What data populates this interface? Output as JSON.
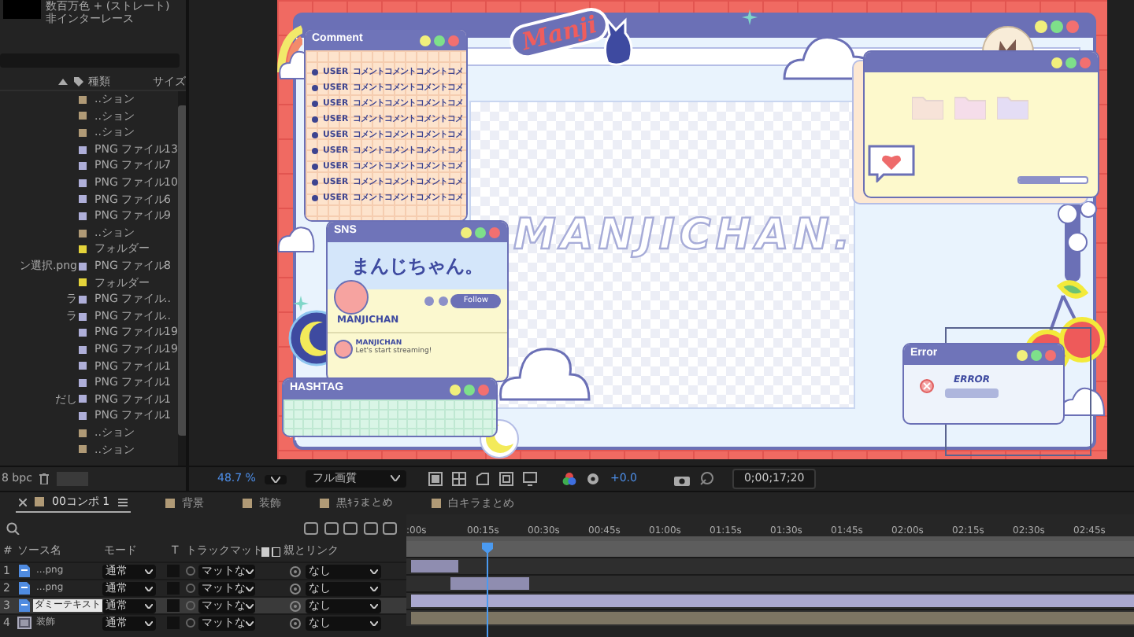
{
  "project": {
    "info": [
      "数百万色 + (ストレート)",
      "非インターレース"
    ],
    "columns": [
      "種類",
      "サイズ"
    ],
    "items": [
      {
        "type": "..ション",
        "color": "#b09a76"
      },
      {
        "type": "..ション",
        "color": "#b09a76"
      },
      {
        "type": "..ション",
        "color": "#b09a76"
      },
      {
        "type": "PNG ファイル",
        "size": "13",
        "color": "#aeaed8"
      },
      {
        "type": "PNG ファイル",
        "size": "7",
        "color": "#aeaed8"
      },
      {
        "type": "PNG ファイル",
        "size": "10",
        "color": "#aeaed8"
      },
      {
        "type": "PNG ファイル",
        "size": "6",
        "color": "#aeaed8"
      },
      {
        "type": "PNG ファイル",
        "size": "9",
        "color": "#aeaed8"
      },
      {
        "type": "..ション",
        "color": "#b09a76"
      },
      {
        "type": "フォルダー",
        "color": "#e4d33a"
      },
      {
        "name": "ン選択.png",
        "type": "PNG ファイル",
        "size": "8",
        "color": "#aeaed8"
      },
      {
        "type": "フォルダー",
        "color": "#e4d33a"
      },
      {
        "name": "ラ",
        "type": "PNG ファイル",
        "size": "..",
        "color": "#aeaed8"
      },
      {
        "name": "ラ",
        "type": "PNG ファイル",
        "size": "..",
        "color": "#aeaed8"
      },
      {
        "type": "PNG ファイル",
        "size": "19",
        "color": "#aeaed8"
      },
      {
        "type": "PNG ファイル",
        "size": "19",
        "color": "#aeaed8"
      },
      {
        "type": "PNG ファイル",
        "size": "1",
        "color": "#aeaed8"
      },
      {
        "type": "PNG ファイル",
        "size": "1",
        "color": "#aeaed8"
      },
      {
        "name": "だし",
        "type": "PNG ファイル",
        "size": "1",
        "color": "#aeaed8"
      },
      {
        "type": "PNG ファイル",
        "size": "1",
        "color": "#aeaed8"
      },
      {
        "type": "..ション",
        "color": "#b09a76"
      },
      {
        "type": "..ション",
        "color": "#b09a76"
      }
    ],
    "bit_depth": "8 bpc"
  },
  "viewer": {
    "artwork": {
      "logo": "Manji",
      "headline": "MANJICHAN.",
      "comment_window": {
        "title": "Comment",
        "rows": [
          {
            "user": "USER",
            "text": "コメントコメントコメントコメ"
          },
          {
            "user": "USER",
            "text": "コメントコメントコメントコメ"
          },
          {
            "user": "USER",
            "text": "コメントコメントコメントコメ"
          },
          {
            "user": "USER",
            "text": "コメントコメントコメントコメ"
          },
          {
            "user": "USER",
            "text": "コメントコメントコメントコメ"
          },
          {
            "user": "USER",
            "text": "コメントコメントコメントコメ"
          },
          {
            "user": "USER",
            "text": "コメントコメントコメントコメ"
          },
          {
            "user": "USER",
            "text": "コメントコメントコメントコメ"
          },
          {
            "user": "USER",
            "text": "コメントコメントコメントコメ"
          }
        ]
      },
      "sns_window": {
        "title": "SNS",
        "banner": "まんじちゃん。",
        "follow_button": "Follow",
        "display_name": "MANJICHAN",
        "post": {
          "author": "MANJICHAN",
          "text": "Let's start streaming!"
        }
      },
      "hashtag_window": {
        "title": "HASHTAG"
      },
      "folder_window": {
        "level": 0.6
      },
      "error_window": {
        "title": "Error",
        "message": "ERROR"
      }
    },
    "toolbar": {
      "zoom": "48.7 %",
      "quality": "フル画質",
      "exposure": "+0.0",
      "timecode": "0;00;17;20"
    }
  },
  "timeline": {
    "tabs": [
      {
        "label": "00コンポ 1",
        "color": "#b09a76",
        "selected": true
      },
      {
        "label": "背景",
        "color": "#b09a76",
        "selected": false
      },
      {
        "label": "装飾",
        "color": "#b09a76",
        "selected": false
      },
      {
        "label": "黒ｷﾗまとめ",
        "color": "#b09a76",
        "selected": false
      },
      {
        "label": "白キラまとめ",
        "color": "#b09a76",
        "selected": false
      }
    ],
    "ruler": [
      ":00s",
      "00:15s",
      "00:30s",
      "00:45s",
      "01:00s",
      "01:15s",
      "01:30s",
      "01:45s",
      "02:00s",
      "02:15s",
      "02:30s",
      "02:45s"
    ],
    "columns": {
      "number": "#",
      "source": "ソース名",
      "mode": "モード",
      "t": "T",
      "track_matte": "トラックマット",
      "parent": "親とリンク"
    },
    "layers": [
      {
        "number": "1",
        "kind": "file",
        "name": "...png",
        "mode": "通常",
        "track_matte": "マットな",
        "parent": "なし",
        "selected": false
      },
      {
        "number": "2",
        "kind": "file",
        "name": "...png",
        "mode": "通常",
        "track_matte": "マットな",
        "parent": "なし",
        "selected": false
      },
      {
        "number": "3",
        "kind": "file",
        "name": "ダミーテキスト",
        "mode": "通常",
        "track_matte": "マットな",
        "parent": "なし",
        "selected": true
      },
      {
        "number": "4",
        "kind": "composition",
        "name": "装飾",
        "mode": "通常",
        "track_matte": "マットな",
        "parent": "なし",
        "selected": false
      }
    ]
  }
}
